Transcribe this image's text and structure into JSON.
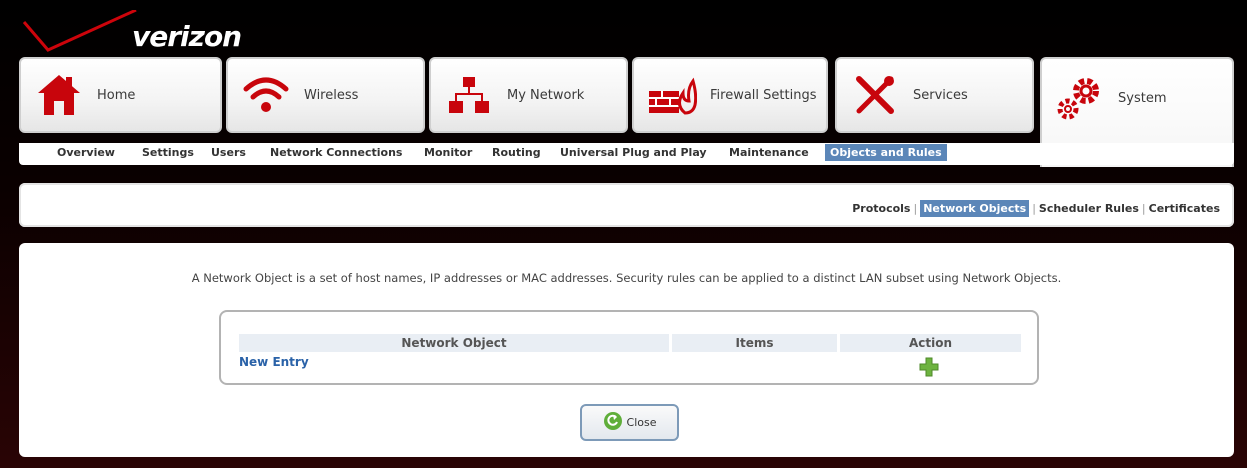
{
  "brand": {
    "logo_text": "verizon",
    "accent_color": "#cd040b"
  },
  "tabs": [
    {
      "label": "Home",
      "icon": "home-icon"
    },
    {
      "label": "Wireless",
      "icon": "wireless-icon"
    },
    {
      "label": "My Network",
      "icon": "network-icon"
    },
    {
      "label": "Firewall Settings",
      "icon": "firewall-icon"
    },
    {
      "label": "Services",
      "icon": "tools-icon"
    },
    {
      "label": "System",
      "icon": "gears-icon",
      "active": true
    }
  ],
  "subnav": [
    "Overview",
    "Settings",
    "Users",
    "Network Connections",
    "Monitor",
    "Routing",
    "Universal Plug and Play",
    "Maintenance",
    "Objects and Rules"
  ],
  "subnav_active": "Objects and Rules",
  "toplinks": [
    "Protocols",
    "Network Objects",
    "Scheduler Rules",
    "Certificates"
  ],
  "toplinks_active": "Network Objects",
  "description": "A Network Object is a set of host names, IP addresses or MAC addresses. Security rules can be applied to a distinct LAN subset using Network Objects.",
  "table": {
    "headers": [
      "Network Object",
      "Items",
      "Action"
    ],
    "new_entry": "New Entry"
  },
  "close_label": "Close",
  "colors": {
    "link": "#2a62a8",
    "highlight": "#5b86b8",
    "plus": "#6db33f"
  }
}
